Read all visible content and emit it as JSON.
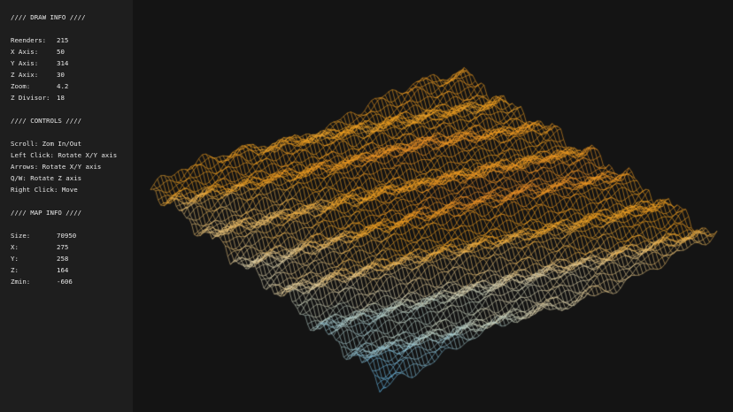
{
  "draw_info": {
    "title": "//// DRAW INFO ////",
    "rows": [
      {
        "label": "Reenders:",
        "value": "215"
      },
      {
        "label": "X Axis:",
        "value": "50"
      },
      {
        "label": "Y Axis:",
        "value": "314"
      },
      {
        "label": "Z Axix:",
        "value": "30"
      },
      {
        "label": "Zoom:",
        "value": "4.2"
      },
      {
        "label": "Z Divisor:",
        "value": "18"
      }
    ]
  },
  "controls": {
    "title": "//// CONTROLS ////",
    "items": [
      "Scroll: Zom In/Out",
      "Left Click: Rotate X/Y axis",
      "Arrows: Rotate X/Y axis",
      "Q/W: Rotate Z axis",
      "Right Click: Move"
    ]
  },
  "map_info": {
    "title": "//// MAP INFO ////",
    "rows": [
      {
        "label": "Size:",
        "value": "70950"
      },
      {
        "label": "X:",
        "value": "275"
      },
      {
        "label": "Y:",
        "value": "258"
      },
      {
        "label": "Z:",
        "value": "164"
      },
      {
        "label": "Zmin:",
        "value": "-606"
      }
    ]
  },
  "colors": {
    "background": "#141414",
    "sidebar": "#1e1e1e",
    "text": "#e6e6e6",
    "terrain_high": "#e05a2a",
    "terrain_mid": "#f0a020",
    "terrain_low": "#59b8f0"
  }
}
